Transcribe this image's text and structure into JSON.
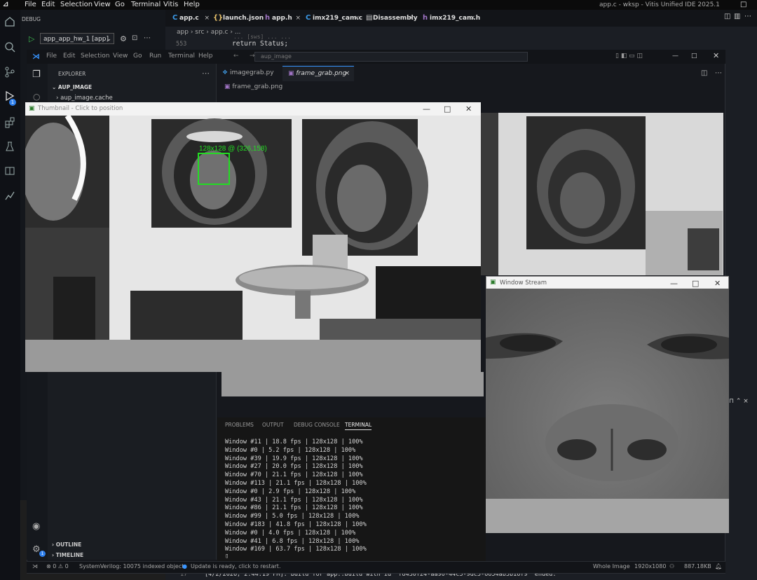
{
  "outer": {
    "menu": [
      "File",
      "Edit",
      "Selection",
      "View",
      "Go",
      "Terminal",
      "Vitis",
      "Help"
    ],
    "window_title": "app.c - wksp - Vitis Unified IDE 2025.1",
    "debug_label": "DEBUG",
    "run_config": "app_app_hw_1 [app]",
    "tabs": [
      "app.c",
      "launch.json",
      "app.h",
      "imx219_cam.c",
      "Disassembly",
      "imx219_cam.h"
    ],
    "breadcrumb": [
      "app",
      "src",
      "app.c",
      "..."
    ],
    "line_number_top": "553",
    "code_top": "return Status;",
    "code_top_partial": "... [sws] ... ...",
    "line_number_bottom": "17",
    "code_bottom": "[4/2/2026, 2:44:19 PM]: Build for app::build with id 'f8430f24-aa90-44c3-9dc5-6654ab3b16f9' ended.",
    "badge_count": "1"
  },
  "vscode": {
    "menu": [
      "File",
      "Edit",
      "Selection",
      "View",
      "Go",
      "Run",
      "Terminal",
      "Help"
    ],
    "search_placeholder": "aup_image",
    "explorer_label": "EXPLORER",
    "project": "AUP_IMAGE",
    "tree_item": "aup_image.cache",
    "tabs": [
      "imagegrab.py",
      "frame_grab.png"
    ],
    "breadcrumb": "frame_grab.png",
    "outline": "OUTLINE",
    "timeline": "TIMELINE",
    "status": {
      "errors": "0",
      "warnings": "0",
      "indexed": "SystemVerilog: 10075 indexed objects",
      "update": "Update is ready, click to restart.",
      "whole_image": "Whole Image",
      "resolution": "1920x1080",
      "size": "887.18KB"
    },
    "panel_tabs": [
      "PROBLEMS",
      "OUTPUT",
      "DEBUG CONSOLE",
      "TERMINAL"
    ],
    "terminal_lines": [
      "Window #11 | 18.8 fps | 128x128 | 100%",
      "Window #0 | 5.2 fps | 128x128 | 100%",
      "Window #39 | 19.9 fps | 128x128 | 100%",
      "Window #27 | 20.0 fps | 128x128 | 100%",
      "Window #70 | 21.1 fps | 128x128 | 100%",
      "Window #113 | 21.1 fps | 128x128 | 100%",
      "Window #0 | 2.9 fps | 128x128 | 100%",
      "Window #43 | 21.1 fps | 128x128 | 100%",
      "Window #86 | 21.1 fps | 128x128 | 100%",
      "Window #99 | 5.0 fps | 128x128 | 100%",
      "Window #183 | 41.8 fps | 128x128 | 100%",
      "Window #0 | 4.0 fps | 128x128 | 100%",
      "Window #41 | 6.8 fps | 128x128 | 100%",
      "Window #169 | 63.7 fps | 128x128 | 100%"
    ],
    "cursor": "▯"
  },
  "thumbnail_window": {
    "title": "Thumbnail - Click to position",
    "roi_label": "128x128 @ (326,158)"
  },
  "stream_window": {
    "title": "Window Stream"
  },
  "colors": {
    "roi": "#22dd22",
    "accent_blue": "#3794ff",
    "badge": "#2f80ed"
  }
}
